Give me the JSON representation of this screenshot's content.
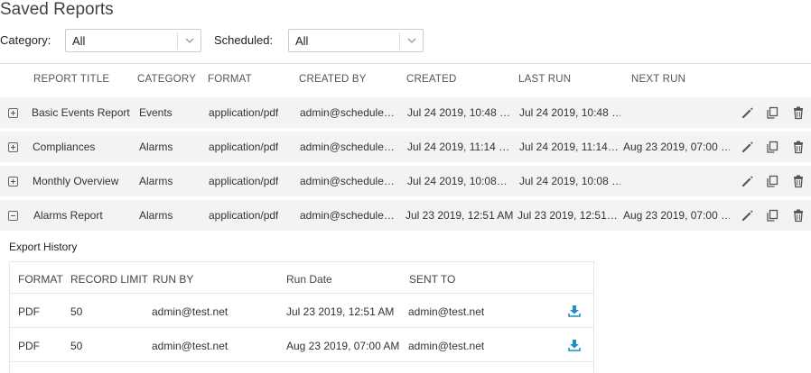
{
  "page": {
    "title": "Saved Reports"
  },
  "filters": {
    "category_label": "Category:",
    "category_value": "All",
    "scheduled_label": "Scheduled:",
    "scheduled_value": "All"
  },
  "table": {
    "headers": [
      "REPORT TITLE",
      "CATEGORY",
      "FORMAT",
      "CREATED BY",
      "CREATED",
      "LAST RUN",
      "NEXT RUN"
    ],
    "rows": [
      {
        "expanded": false,
        "title": "Basic Events Report",
        "category": "Events",
        "format": "application/pdf",
        "created_by": "admin@schedule…",
        "created": "Jul 24 2019, 10:48 …",
        "last_run": "Jul 24 2019, 10:48 …",
        "next_run": ""
      },
      {
        "expanded": false,
        "title": "Compliances",
        "category": "Alarms",
        "format": "application/pdf",
        "created_by": "admin@schedule…",
        "created": "Jul 24 2019, 11:14 …",
        "last_run": "Jul 24 2019, 11:14…",
        "next_run": "Aug 23 2019, 07:00 …"
      },
      {
        "expanded": false,
        "title": "Monthly Overview",
        "category": "Alarms",
        "format": "application/pdf",
        "created_by": "admin@schedule…",
        "created": "Jul 24 2019, 10:08…",
        "last_run": "Jul 24 2019, 10:08 …",
        "next_run": ""
      },
      {
        "expanded": true,
        "title": "Alarms Report",
        "category": "Alarms",
        "format": "application/pdf",
        "created_by": "admin@schedule…",
        "created": "Jul 23 2019, 12:51 AM",
        "last_run": "Jul 23 2019, 12:51…",
        "next_run": "Aug 23 2019, 07:00 …"
      }
    ]
  },
  "export_history": {
    "title": "Export History",
    "headers": [
      "FORMAT",
      "RECORD LIMIT",
      "RUN BY",
      "Run Date",
      "SENT TO"
    ],
    "rows": [
      {
        "format": "PDF",
        "record_limit": "50",
        "run_by": "admin@test.net",
        "run_date": "Jul 23 2019, 12:51 AM",
        "sent_to": "admin@test.net"
      },
      {
        "format": "PDF",
        "record_limit": "50",
        "run_by": "admin@test.net",
        "run_date": "Aug 23 2019, 07:00 AM",
        "sent_to": "admin@test.net"
      }
    ]
  },
  "icons": {
    "edit": "pencil-icon",
    "copy": "copy-icon",
    "delete": "trash-icon",
    "download": "download-icon",
    "expand": "plus-square-icon",
    "collapse": "minus-square-icon"
  },
  "colors": {
    "row_bg": "#f3f3f3",
    "download_accent": "#1f8ec4",
    "action_icon": "#555555"
  }
}
